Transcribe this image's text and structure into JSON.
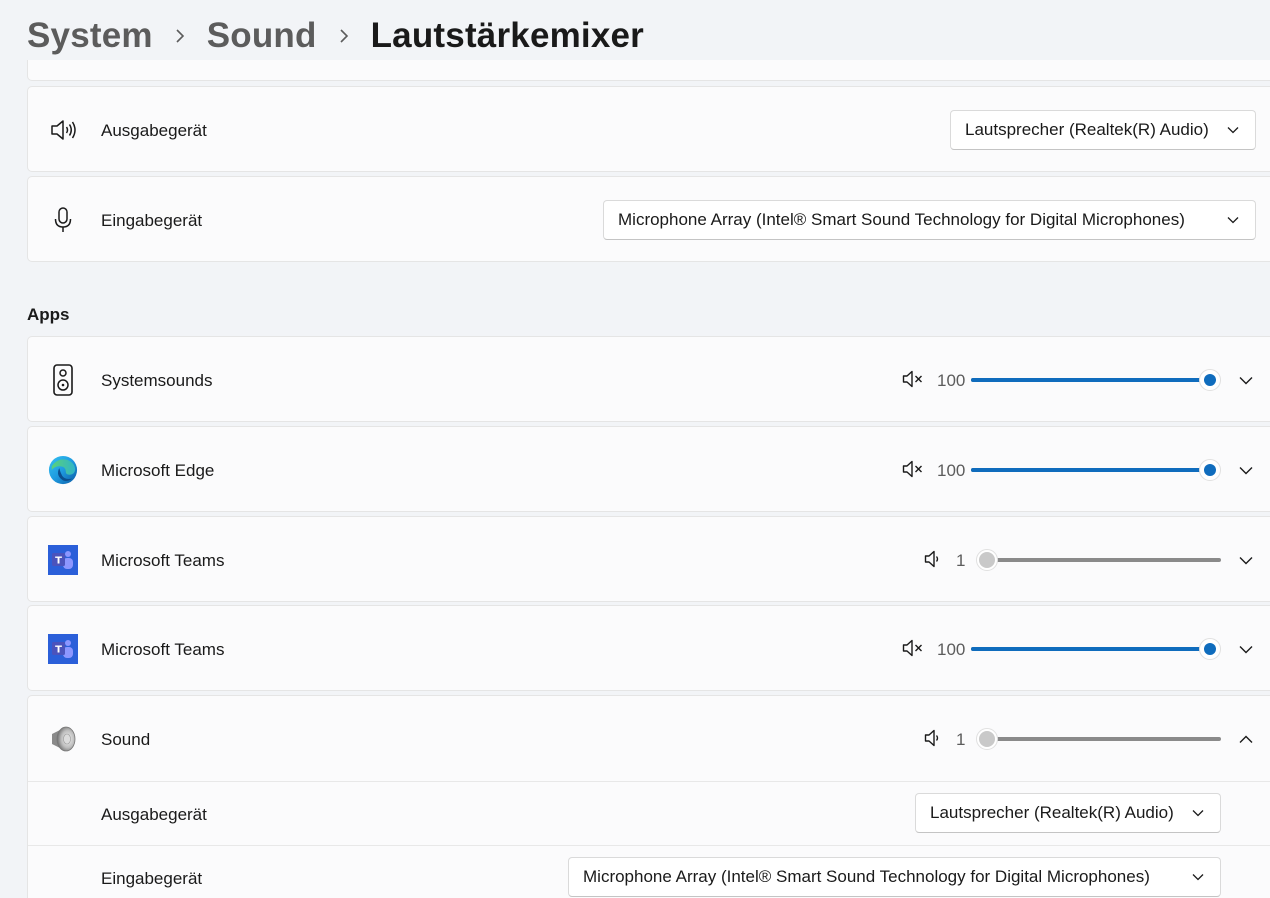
{
  "breadcrumb": {
    "items": [
      "System",
      "Sound"
    ],
    "current": "Lautstärkemixer"
  },
  "devices": {
    "output": {
      "label": "Ausgabegerät",
      "value": "Lautsprecher (Realtek(R) Audio)",
      "icon": "speaker-volume-icon"
    },
    "input": {
      "label": "Eingabegerät",
      "value": "Microphone Array (Intel® Smart Sound Technology for Digital Microphones)",
      "icon": "microphone-icon"
    }
  },
  "apps_section": {
    "title": "Apps",
    "apps": [
      {
        "name": "Systemsounds",
        "icon": "system-speaker-icon",
        "volume": "100",
        "volume_level": 1.0,
        "muted": true,
        "expanded": false
      },
      {
        "name": "Microsoft Edge",
        "icon": "edge-logo-icon",
        "volume": "100",
        "volume_level": 1.0,
        "muted": true,
        "expanded": false
      },
      {
        "name": "Microsoft Teams",
        "icon": "teams-logo-icon",
        "volume": "1",
        "volume_level": 0.01,
        "muted": false,
        "expanded": false
      },
      {
        "name": "Microsoft Teams",
        "icon": "teams-logo-icon",
        "volume": "100",
        "volume_level": 1.0,
        "muted": true,
        "expanded": false
      },
      {
        "name": "Sound",
        "icon": "sound-app-icon",
        "volume": "1",
        "volume_level": 0.01,
        "muted": false,
        "expanded": true,
        "details": {
          "output_label": "Ausgabegerät",
          "output_value": "Lautsprecher (Realtek(R) Audio)",
          "input_label": "Eingabegerät",
          "input_value": "Microphone Array (Intel® Smart Sound Technology for Digital Microphones)"
        }
      }
    ]
  },
  "colors": {
    "accent": "#0f6cbd",
    "background": "#f2f4f7",
    "card": "#fbfbfc"
  }
}
